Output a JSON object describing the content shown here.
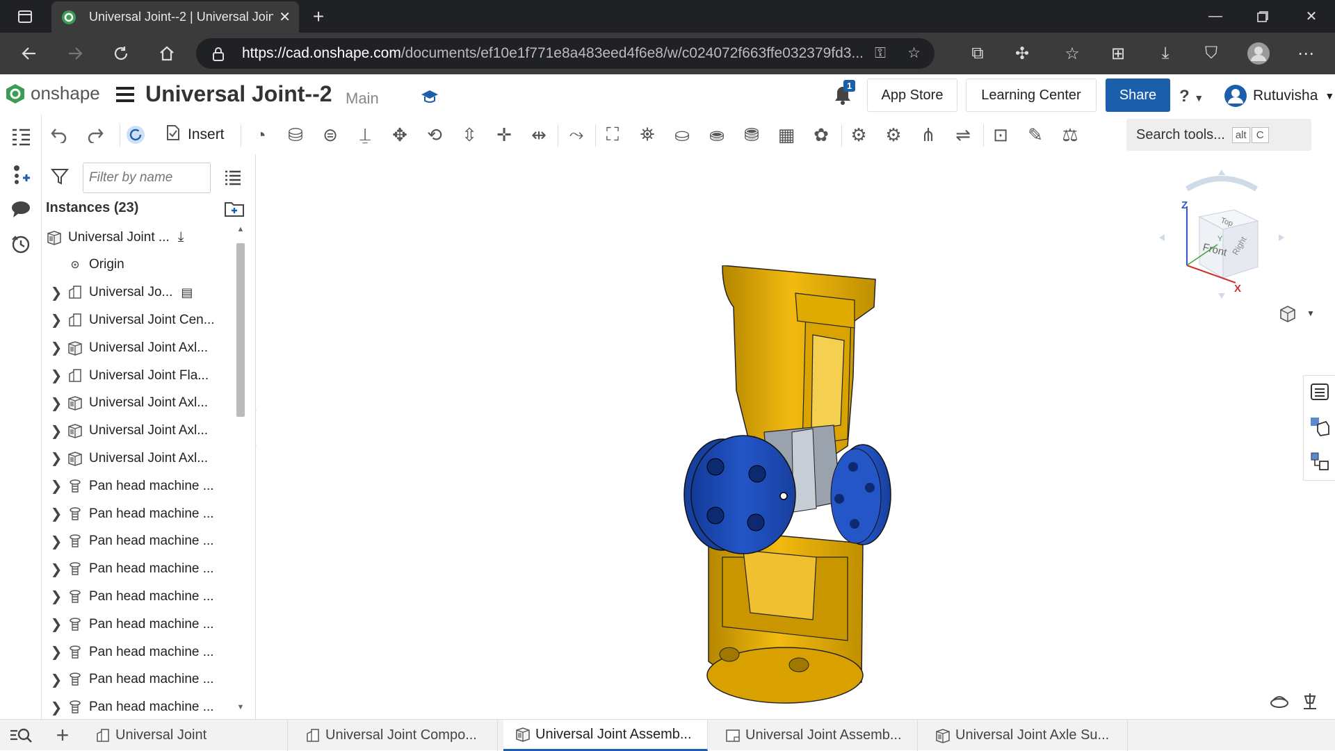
{
  "browser": {
    "tab_title": "Universal Joint--2 | Universal Join",
    "url_host": "https://cad.onshape.com",
    "url_path": "/documents/ef10e1f771e8a483eed4f6e8/w/c024072f663ffe032379fd3..."
  },
  "app": {
    "logo_text": "onshape",
    "doc_title": "Universal Joint--2",
    "branch": "Main",
    "notification_count": "1",
    "app_store": "App Store",
    "learning_center": "Learning Center",
    "share": "Share",
    "help": "?",
    "user_name": "Rutuvisha"
  },
  "toolbar": {
    "insert": "Insert",
    "search_placeholder": "Search tools...",
    "search_key1": "alt",
    "search_key2": "C"
  },
  "panel": {
    "filter_placeholder": "Filter by name",
    "instances_header": "Instances (23)",
    "items": [
      {
        "label": "Universal Joint ...",
        "chevron": false,
        "icon": "assembly-icon",
        "indent": 0
      },
      {
        "label": "Origin",
        "chevron": false,
        "icon": "origin-icon",
        "indent": 1
      },
      {
        "label": "Universal Jo...",
        "chevron": true,
        "icon": "part-studio-icon",
        "indent": 0
      },
      {
        "label": "Universal Joint Cen...",
        "chevron": true,
        "icon": "part-studio-icon",
        "indent": 0
      },
      {
        "label": "Universal Joint Axl...",
        "chevron": true,
        "icon": "assembly-icon",
        "indent": 0
      },
      {
        "label": "Universal Joint Fla...",
        "chevron": true,
        "icon": "part-studio-icon",
        "indent": 0
      },
      {
        "label": "Universal Joint Axl...",
        "chevron": true,
        "icon": "assembly-icon",
        "indent": 0
      },
      {
        "label": "Universal Joint Axl...",
        "chevron": true,
        "icon": "assembly-icon",
        "indent": 0
      },
      {
        "label": "Universal Joint Axl...",
        "chevron": true,
        "icon": "assembly-icon",
        "indent": 0
      },
      {
        "label": "Pan head machine ...",
        "chevron": true,
        "icon": "screw-icon",
        "indent": 0
      },
      {
        "label": "Pan head machine ...",
        "chevron": true,
        "icon": "screw-icon",
        "indent": 0
      },
      {
        "label": "Pan head machine ...",
        "chevron": true,
        "icon": "screw-icon",
        "indent": 0
      },
      {
        "label": "Pan head machine ...",
        "chevron": true,
        "icon": "screw-icon",
        "indent": 0
      },
      {
        "label": "Pan head machine ...",
        "chevron": true,
        "icon": "screw-icon",
        "indent": 0
      },
      {
        "label": "Pan head machine ...",
        "chevron": true,
        "icon": "screw-icon",
        "indent": 0
      },
      {
        "label": "Pan head machine ...",
        "chevron": true,
        "icon": "screw-icon",
        "indent": 0
      },
      {
        "label": "Pan head machine ...",
        "chevron": true,
        "icon": "screw-icon",
        "indent": 0
      },
      {
        "label": "Pan head machine ...",
        "chevron": true,
        "icon": "screw-icon",
        "indent": 0
      }
    ]
  },
  "viewcube": {
    "top": "Top",
    "front": "Front",
    "right": "Right",
    "axis_z": "Z",
    "axis_x": "X",
    "axis_y": "Y"
  },
  "bottom_tabs": [
    {
      "label": "Universal Joint",
      "icon": "part-studio-icon",
      "active": false
    },
    {
      "label": "Universal Joint Compo...",
      "icon": "part-studio-icon",
      "active": false
    },
    {
      "label": "Universal Joint Assemb...",
      "icon": "assembly-icon",
      "active": true
    },
    {
      "label": "Universal Joint Assemb...",
      "icon": "drawing-icon",
      "active": false
    },
    {
      "label": "Universal Joint Axle Su...",
      "icon": "assembly-icon",
      "active": false
    }
  ],
  "colors": {
    "accent": "#1b5fac",
    "yoke": "#e4ac00",
    "flange": "#1d46b0",
    "cross": "#9aa3ad"
  }
}
